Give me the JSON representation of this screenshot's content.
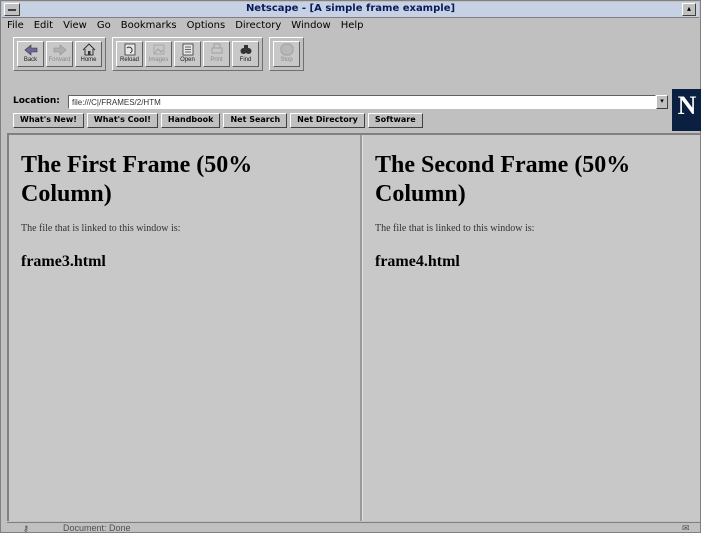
{
  "window": {
    "title": "Netscape - [A simple frame example]"
  },
  "menu": [
    "File",
    "Edit",
    "View",
    "Go",
    "Bookmarks",
    "Options",
    "Directory",
    "Window",
    "Help"
  ],
  "toolbar": {
    "groups": [
      [
        {
          "label": "Back",
          "icon": "back-icon",
          "enabled": true
        },
        {
          "label": "Forward",
          "icon": "forward-icon",
          "enabled": false
        },
        {
          "label": "Home",
          "icon": "home-icon",
          "enabled": true
        }
      ],
      [
        {
          "label": "Reload",
          "icon": "reload-icon",
          "enabled": true
        },
        {
          "label": "Images",
          "icon": "images-icon",
          "enabled": false
        },
        {
          "label": "Open",
          "icon": "open-icon",
          "enabled": true
        },
        {
          "label": "Print",
          "icon": "print-icon",
          "enabled": false
        },
        {
          "label": "Find",
          "icon": "find-icon",
          "enabled": true
        }
      ],
      [
        {
          "label": "Stop",
          "icon": "stop-icon",
          "enabled": false
        }
      ]
    ]
  },
  "location": {
    "label": "Location:",
    "value": "file:///C|/FRAMES/2/HTM"
  },
  "directory_buttons": [
    "What's New!",
    "What's Cool!",
    "Handbook",
    "Net Search",
    "Net Directory",
    "Software"
  ],
  "frames": [
    {
      "heading": "The First Frame (50% Column)",
      "text": "The file that is linked to this window is:",
      "filename": "frame3.html"
    },
    {
      "heading": "The Second Frame (50% Column)",
      "text": "The file that is linked to this window is:",
      "filename": "frame4.html"
    }
  ],
  "status": {
    "text": "Document: Done"
  },
  "logo": {
    "letter": "N"
  }
}
